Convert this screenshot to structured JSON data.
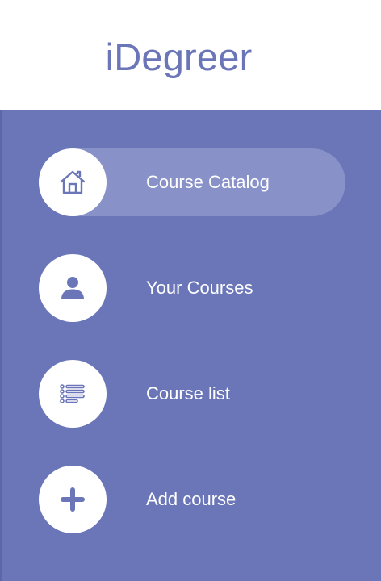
{
  "header": {
    "title": "iDegreer"
  },
  "colors": {
    "brand": "#6b76b8",
    "active_item": "#8891c8",
    "text_on_brand": "#ffffff"
  },
  "nav": {
    "items": [
      {
        "label": "Course Catalog",
        "icon": "home-icon",
        "active": true
      },
      {
        "label": "Your Courses",
        "icon": "user-icon",
        "active": false
      },
      {
        "label": "Course list",
        "icon": "list-icon",
        "active": false
      },
      {
        "label": "Add course",
        "icon": "plus-icon",
        "active": false
      }
    ]
  }
}
